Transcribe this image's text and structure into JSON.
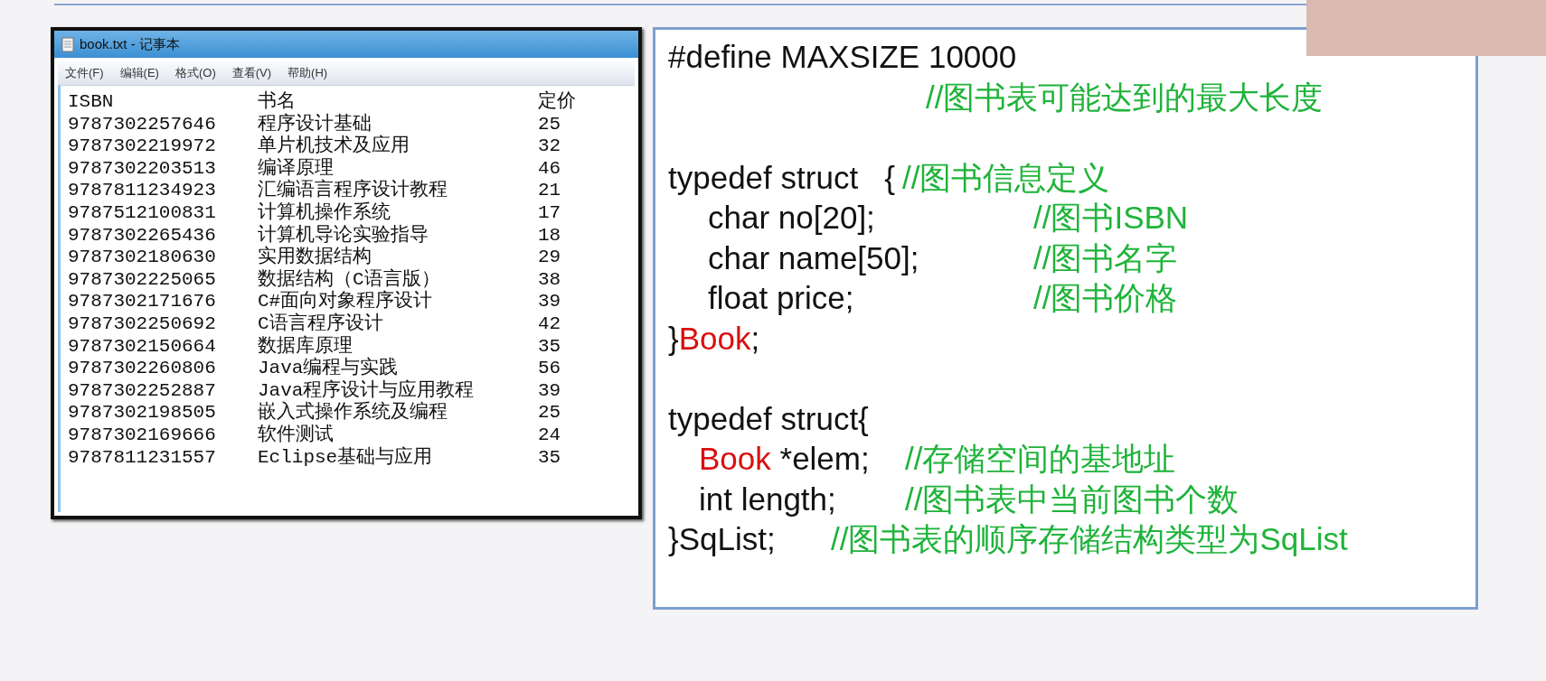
{
  "notepad": {
    "title": "book.txt - 记事本",
    "menu": [
      "文件(F)",
      "编辑(E)",
      "格式(O)",
      "查看(V)",
      "帮助(H)"
    ],
    "header": [
      "ISBN",
      "书名",
      "定价"
    ],
    "rows": [
      [
        "9787302257646",
        "程序设计基础",
        "25"
      ],
      [
        "9787302219972",
        "单片机技术及应用",
        "32"
      ],
      [
        "9787302203513",
        "编译原理",
        "46"
      ],
      [
        "9787811234923",
        "汇编语言程序设计教程",
        "21"
      ],
      [
        "9787512100831",
        "计算机操作系统",
        "17"
      ],
      [
        "9787302265436",
        "计算机导论实验指导",
        "18"
      ],
      [
        "9787302180630",
        "实用数据结构",
        "29"
      ],
      [
        "9787302225065",
        "数据结构（C语言版）",
        "38"
      ],
      [
        "9787302171676",
        "C#面向对象程序设计",
        "39"
      ],
      [
        "9787302250692",
        "C语言程序设计",
        "42"
      ],
      [
        "9787302150664",
        "数据库原理",
        "35"
      ],
      [
        "9787302260806",
        "Java编程与实践",
        "56"
      ],
      [
        "9787302252887",
        "Java程序设计与应用教程",
        "39"
      ],
      [
        "9787302198505",
        "嵌入式操作系统及编程",
        "25"
      ],
      [
        "9787302169666",
        "软件测试",
        "24"
      ],
      [
        "9787811231557",
        "Eclipse基础与应用",
        "35"
      ]
    ]
  },
  "code": [
    {
      "kind": "top",
      "parts": [
        {
          "kind": "plain",
          "text": "#define MAXSIZE 10000"
        }
      ]
    },
    {
      "kind": "note",
      "comment": "//图书表可能达到的最大长度"
    },
    {
      "kind": "blank"
    },
    {
      "kind": "top",
      "parts": [
        {
          "kind": "plain",
          "text": "typedef struct   {"
        }
      ],
      "comment": "//图书信息定义"
    },
    {
      "kind": "field",
      "parts": [
        {
          "kind": "plain",
          "text": "char no[20];"
        }
      ],
      "comment": "//图书ISBN"
    },
    {
      "kind": "field",
      "parts": [
        {
          "kind": "plain",
          "text": "char name[50];"
        }
      ],
      "comment": "//图书名字"
    },
    {
      "kind": "field",
      "parts": [
        {
          "kind": "plain",
          "text": "float price;"
        }
      ],
      "comment": "//图书价格"
    },
    {
      "kind": "top",
      "parts": [
        {
          "kind": "plain",
          "text": "}"
        },
        {
          "kind": "type",
          "text": "Book"
        },
        {
          "kind": "plain",
          "text": ";"
        }
      ]
    },
    {
      "kind": "blank"
    },
    {
      "kind": "top",
      "parts": [
        {
          "kind": "plain",
          "text": "typedef struct{"
        }
      ]
    },
    {
      "kind": "member",
      "parts": [
        {
          "kind": "type",
          "text": "Book"
        },
        {
          "kind": "plain",
          "text": " *elem;"
        }
      ],
      "comment": "//存储空间的基地址"
    },
    {
      "kind": "member",
      "parts": [
        {
          "kind": "plain",
          "text": "int length;"
        }
      ],
      "comment": "//图书表中当前图书个数"
    },
    {
      "kind": "tail",
      "parts": [
        {
          "kind": "plain",
          "text": "}SqList;"
        }
      ],
      "comment": "//图书表的顺序存储结构类型为SqList"
    }
  ]
}
